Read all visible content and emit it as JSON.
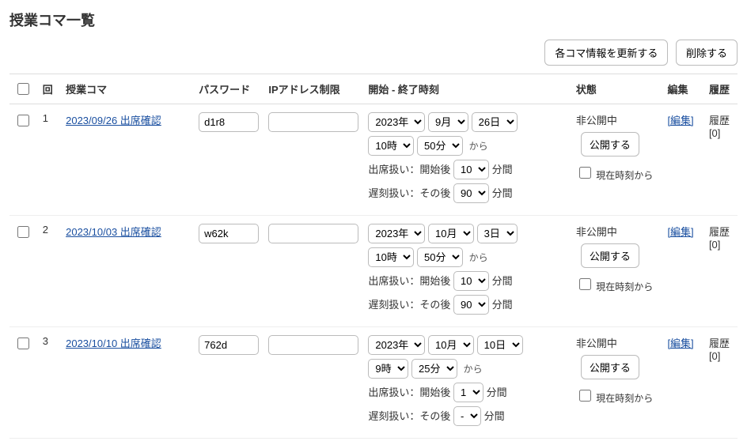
{
  "title": "授業コマ一覧",
  "top_buttons": {
    "refresh": "各コマ情報を更新する",
    "delete": "削除する"
  },
  "headers": {
    "seq": "回",
    "name": "授業コマ",
    "password": "パスワード",
    "ip": "IPアドレス制限",
    "time": "開始 - 終了時刻",
    "status": "状態",
    "edit": "編集",
    "history": "履歴"
  },
  "labels": {
    "from": "から",
    "attend_prefix": "出席扱い：開始後",
    "late_prefix": "遅刻扱い：その後",
    "minutes": "分間",
    "publish": "公開する",
    "from_now": "現在時刻から",
    "edit_link": "[編集]",
    "history_word": "履歴"
  },
  "rows": [
    {
      "seq": "1",
      "name": "2023/09/26 出席確認",
      "password": "d1r8",
      "ip": "",
      "year": "2023年",
      "month": "9月",
      "day": "26日",
      "hour": "10時",
      "minute": "50分",
      "attend_min": "10",
      "late_min": "90",
      "status": "非公開中",
      "history_count": "[0]"
    },
    {
      "seq": "2",
      "name": "2023/10/03 出席確認",
      "password": "w62k",
      "ip": "",
      "year": "2023年",
      "month": "10月",
      "day": "3日",
      "hour": "10時",
      "minute": "50分",
      "attend_min": "10",
      "late_min": "90",
      "status": "非公開中",
      "history_count": "[0]"
    },
    {
      "seq": "3",
      "name": "2023/10/10 出席確認",
      "password": "762d",
      "ip": "",
      "year": "2023年",
      "month": "10月",
      "day": "10日",
      "hour": "9時",
      "minute": "25分",
      "attend_min": "1",
      "late_min": "-",
      "status": "非公開中",
      "history_count": "[0]"
    }
  ]
}
